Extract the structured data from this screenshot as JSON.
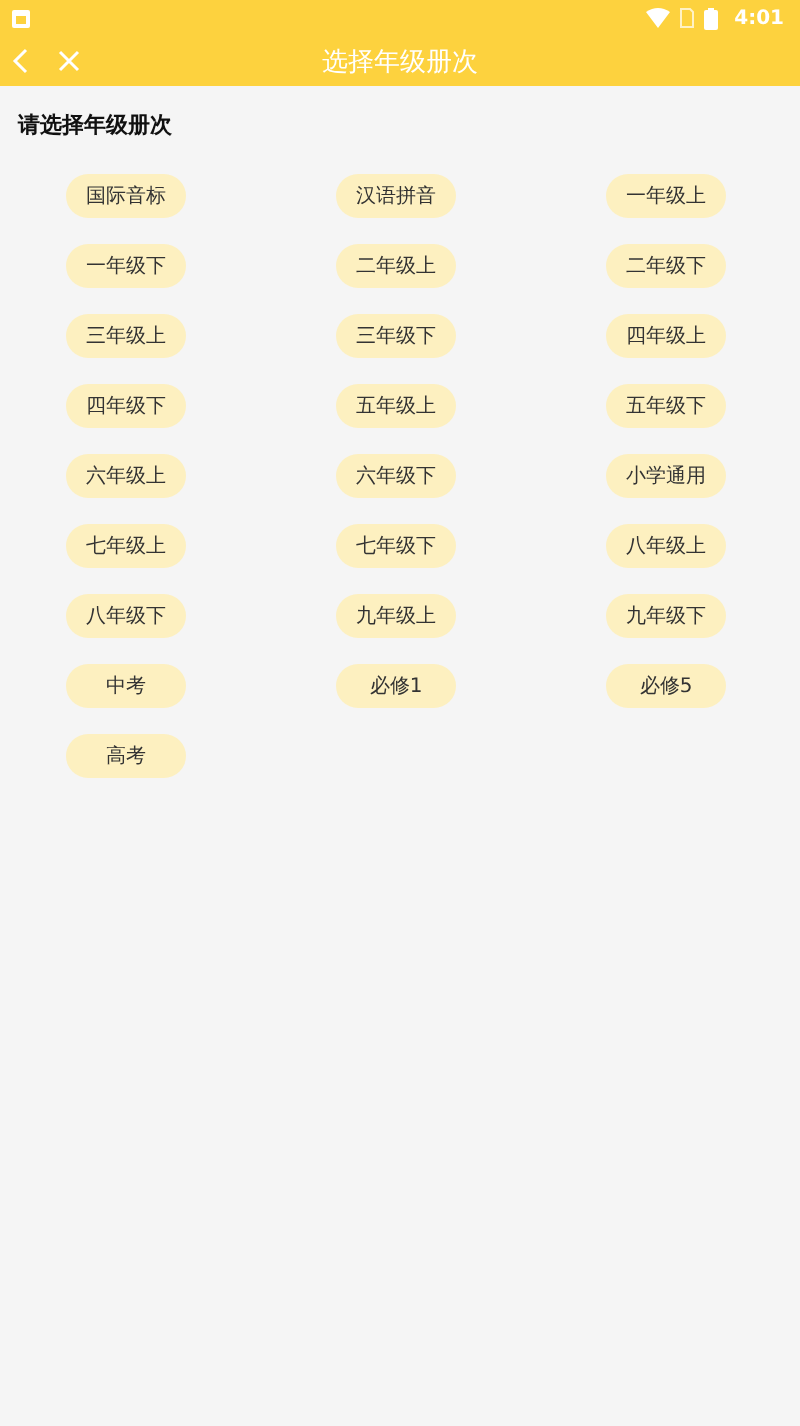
{
  "status_bar": {
    "time": "4:01"
  },
  "app_bar": {
    "title": "选择年级册次"
  },
  "heading": "请选择年级册次",
  "grades": [
    {
      "label": "国际音标"
    },
    {
      "label": "汉语拼音"
    },
    {
      "label": "一年级上"
    },
    {
      "label": "一年级下"
    },
    {
      "label": "二年级上"
    },
    {
      "label": "二年级下"
    },
    {
      "label": "三年级上"
    },
    {
      "label": "三年级下"
    },
    {
      "label": "四年级上"
    },
    {
      "label": "四年级下"
    },
    {
      "label": "五年级上"
    },
    {
      "label": "五年级下"
    },
    {
      "label": "六年级上"
    },
    {
      "label": "六年级下"
    },
    {
      "label": "小学通用"
    },
    {
      "label": "七年级上"
    },
    {
      "label": "七年级下"
    },
    {
      "label": "八年级上"
    },
    {
      "label": "八年级下"
    },
    {
      "label": "九年级上"
    },
    {
      "label": "九年级下"
    },
    {
      "label": "中考"
    },
    {
      "label": "必修1"
    },
    {
      "label": "必修5"
    },
    {
      "label": "高考"
    }
  ]
}
